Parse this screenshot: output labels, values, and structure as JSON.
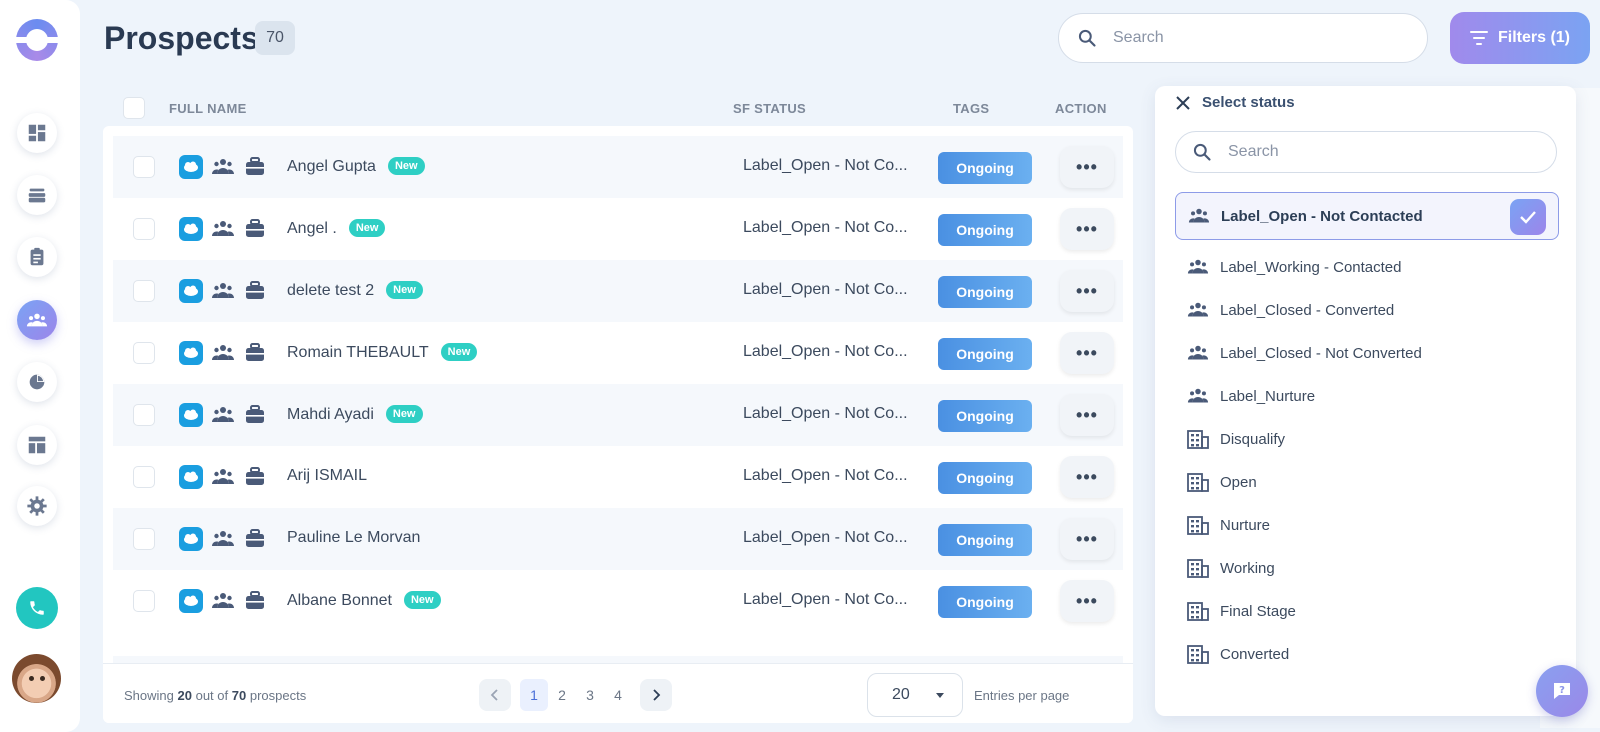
{
  "header": {
    "title": "Prospects",
    "count": "70",
    "search_placeholder": "Search",
    "filters_label": "Filters (1)"
  },
  "sidebar": {
    "items": [
      {
        "icon": "dashboard-icon"
      },
      {
        "icon": "stack-icon"
      },
      {
        "icon": "clipboard-icon"
      },
      {
        "icon": "people-icon",
        "active": true
      },
      {
        "icon": "pie-chart-icon"
      },
      {
        "icon": "layout-icon"
      },
      {
        "icon": "gear-icon"
      }
    ]
  },
  "table": {
    "columns": {
      "full_name": "FULL NAME",
      "sf_status": "SF STATUS",
      "tags": "TAGS",
      "action": "ACTION"
    },
    "new_label": "New",
    "action_label": "•••",
    "rows": [
      {
        "name": "Angel Gupta",
        "is_new": true,
        "status": "Label_Open - Not Co...",
        "tag": "Ongoing"
      },
      {
        "name": "Angel .",
        "is_new": true,
        "status": "Label_Open - Not Co...",
        "tag": "Ongoing"
      },
      {
        "name": "delete test 2",
        "is_new": true,
        "status": "Label_Open - Not Co...",
        "tag": "Ongoing"
      },
      {
        "name": "Romain THEBAULT",
        "is_new": true,
        "status": "Label_Open - Not Co...",
        "tag": "Ongoing"
      },
      {
        "name": "Mahdi Ayadi",
        "is_new": true,
        "status": "Label_Open - Not Co...",
        "tag": "Ongoing"
      },
      {
        "name": "Arij ISMAIL",
        "is_new": false,
        "status": "Label_Open - Not Co...",
        "tag": "Ongoing"
      },
      {
        "name": "Pauline Le Morvan",
        "is_new": false,
        "status": "Label_Open - Not Co...",
        "tag": "Ongoing"
      },
      {
        "name": "Albane Bonnet",
        "is_new": true,
        "status": "Label_Open - Not Co...",
        "tag": "Ongoing"
      }
    ]
  },
  "footer": {
    "showing_prefix": "Showing",
    "showing_count": "20",
    "showing_mid": "out of",
    "showing_total": "70",
    "showing_suffix": "prospects",
    "pages": [
      "1",
      "2",
      "3",
      "4"
    ],
    "current_page": "1",
    "per_page": "20",
    "entries_label": "Entries per page"
  },
  "filter_panel": {
    "title": "Select status",
    "search_placeholder": "Search",
    "options": [
      {
        "label": "Label_Open - Not Contacted",
        "icon": "people-icon",
        "selected": true
      },
      {
        "label": "Label_Working - Contacted",
        "icon": "people-icon",
        "selected": false
      },
      {
        "label": "Label_Closed - Converted",
        "icon": "people-icon",
        "selected": false
      },
      {
        "label": "Label_Closed - Not Converted",
        "icon": "people-icon",
        "selected": false
      },
      {
        "label": "Label_Nurture",
        "icon": "people-icon",
        "selected": false
      },
      {
        "label": "Disqualify",
        "icon": "building-icon",
        "selected": false
      },
      {
        "label": "Open",
        "icon": "building-icon",
        "selected": false
      },
      {
        "label": "Nurture",
        "icon": "building-icon",
        "selected": false
      },
      {
        "label": "Working",
        "icon": "building-icon",
        "selected": false
      },
      {
        "label": "Final Stage",
        "icon": "building-icon",
        "selected": false
      },
      {
        "label": "Converted",
        "icon": "building-icon",
        "selected": false
      }
    ]
  },
  "colors": {
    "accent_gradient_start": "#7aa3f4",
    "accent_gradient_end": "#9c85ea",
    "tag_blue": "#4a90e2",
    "new_badge": "#2ecfc4",
    "phone_green": "#22c6c0",
    "salesforce_blue": "#1a9ee0"
  }
}
